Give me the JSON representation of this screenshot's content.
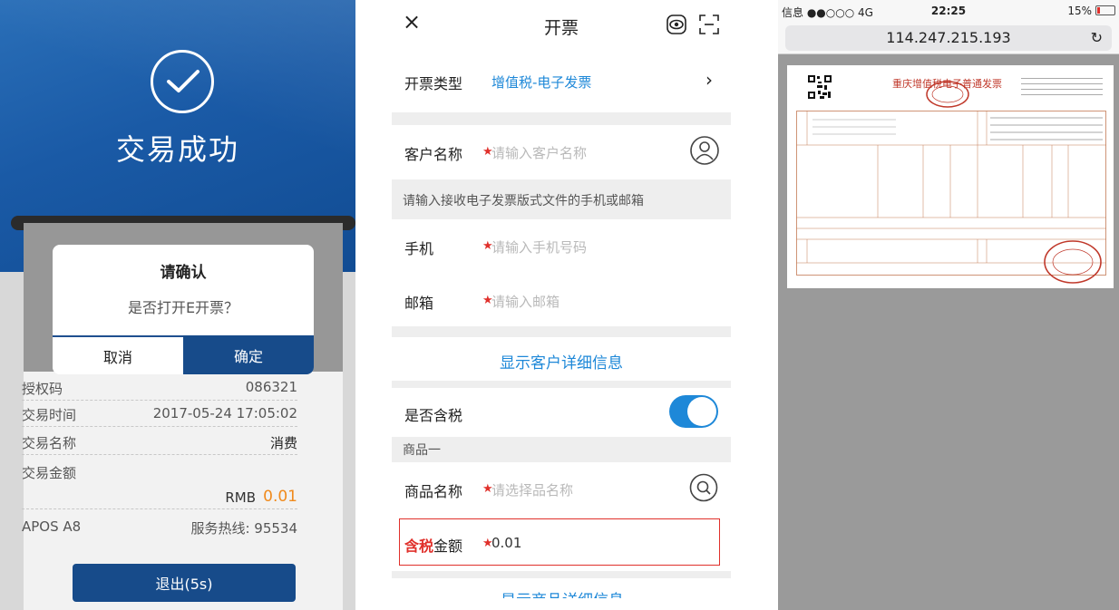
{
  "panel1": {
    "success_title": "交易成功",
    "rows": [
      {
        "key": "授权码",
        "value": "086321"
      },
      {
        "key": "交易时间",
        "value": "2017-05-24 17:05:02"
      },
      {
        "key": "交易名称",
        "value": "消费"
      },
      {
        "key": "交易金额",
        "value": ""
      }
    ],
    "amount_currency": "RMB",
    "amount_value": "0.01",
    "device": "APOS A8",
    "hotline": "服务热线: 95534",
    "exit_label": "退出(5s)",
    "dialog": {
      "title": "请确认",
      "message": "是否打开E开票？",
      "cancel": "取消",
      "confirm": "确定"
    },
    "colors": {
      "brand": "#174b8a",
      "amount": "#f08a1c"
    }
  },
  "panel2": {
    "title": "开票",
    "close_glyph": "×",
    "invoice_type_label": "开票类型",
    "invoice_type_value": "增值税-电子发票",
    "customer_label": "客户名称",
    "customer_placeholder": "请输入客户名称",
    "receive_hint": "请输入接收电子发票版式文件的手机或邮箱",
    "phone_label": "手机",
    "phone_placeholder": "请输入手机号码",
    "email_label": "邮箱",
    "email_placeholder": "请输入邮箱",
    "show_customer_detail": "显示客户详细信息",
    "tax_included_label": "是否含税",
    "tax_included_on": true,
    "product_section": "商品一",
    "product_label": "商品名称",
    "product_placeholder": "请选择品名称",
    "amount_label_red": "含税",
    "amount_label_rest": "金额",
    "amount_value": "0.01",
    "show_product_detail": "显示商品详细信息",
    "colors": {
      "accent": "#1e88d8",
      "required": "#e0302b"
    }
  },
  "panel3": {
    "status_left": "信息 ●●○○○ 4G",
    "time": "22:25",
    "battery": "15%",
    "battery_level": 0.15,
    "url": "114.247.215.193",
    "reload_glyph": "↻",
    "invoice_title": "重庆增值税电子普通发票"
  }
}
